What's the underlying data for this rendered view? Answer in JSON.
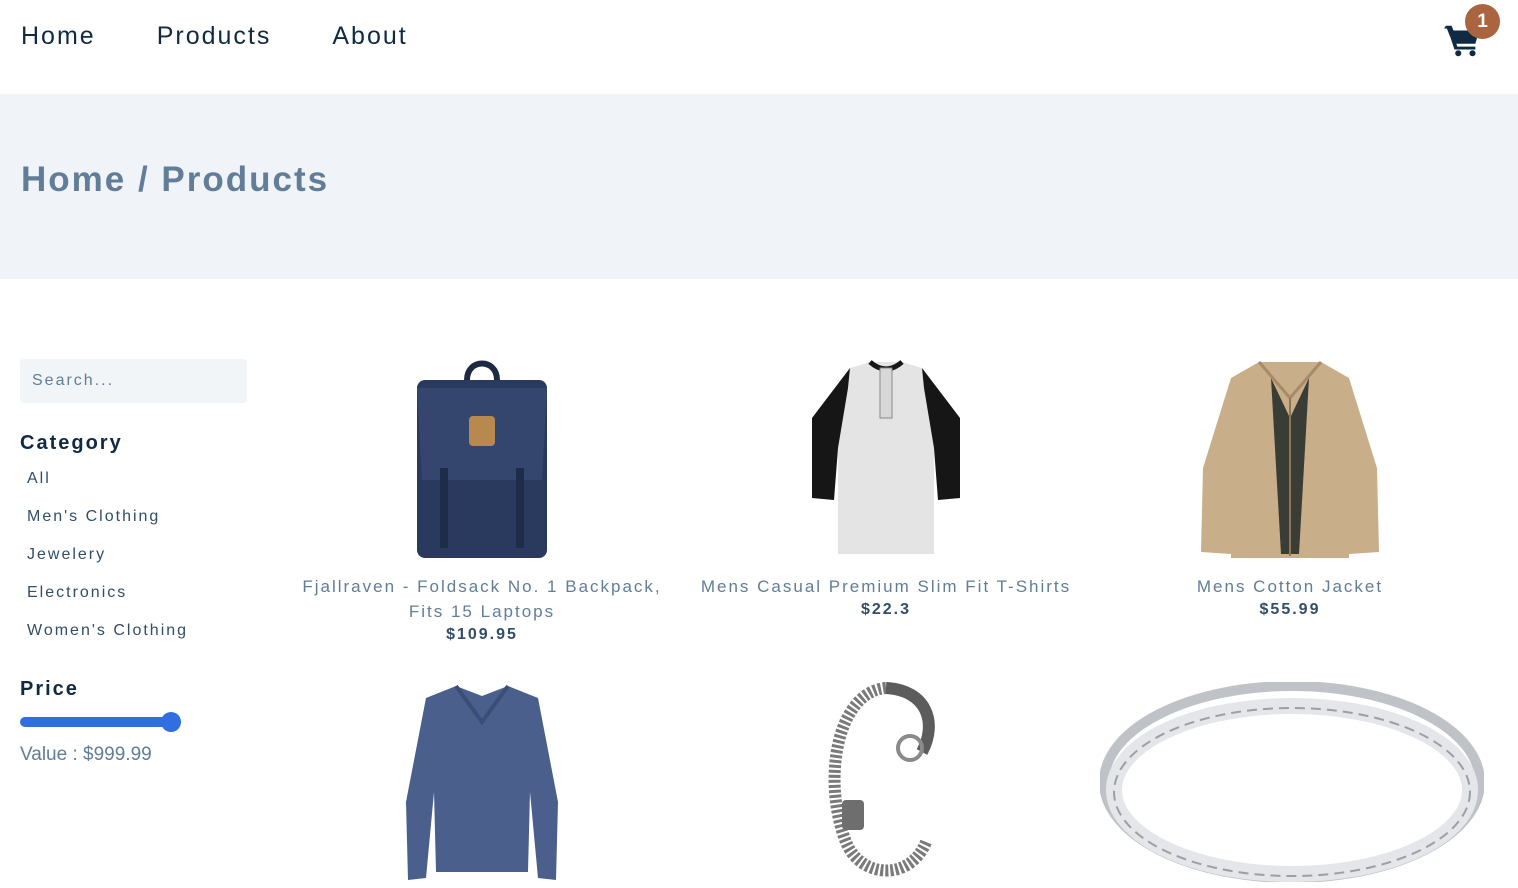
{
  "nav": {
    "links": [
      "Home",
      "Products",
      "About"
    ],
    "cart_count": "1"
  },
  "hero": {
    "title": "Home / Products"
  },
  "filters": {
    "search_placeholder": "Search...",
    "category_title": "Category",
    "categories": [
      "All",
      "Men's Clothing",
      "Jewelery",
      "Electronics",
      "Women's Clothing"
    ],
    "price_title": "Price",
    "price_value_text": "Value : $999.99",
    "price_slider_fraction": 1.0
  },
  "products": [
    {
      "name": "Fjallraven - Foldsack No. 1 Backpack, Fits 15 Laptops",
      "price": "$109.95",
      "image": "backpack"
    },
    {
      "name": "Mens Casual Premium Slim Fit T-Shirts",
      "price": "$22.3",
      "image": "raglan-tshirt"
    },
    {
      "name": "Mens Cotton Jacket",
      "price": "$55.99",
      "image": "jacket"
    },
    {
      "name": "",
      "price": "",
      "image": "long-sleeve-shirt"
    },
    {
      "name": "",
      "price": "",
      "image": "dragon-bracelet"
    },
    {
      "name": "",
      "price": "",
      "image": "silver-ring"
    }
  ],
  "colors": {
    "accent": "#2f6fe0",
    "badge": "#ab6440",
    "hero_bg": "#f0f4f8",
    "text_dark": "#102a43",
    "text_muted": "#617d98"
  }
}
